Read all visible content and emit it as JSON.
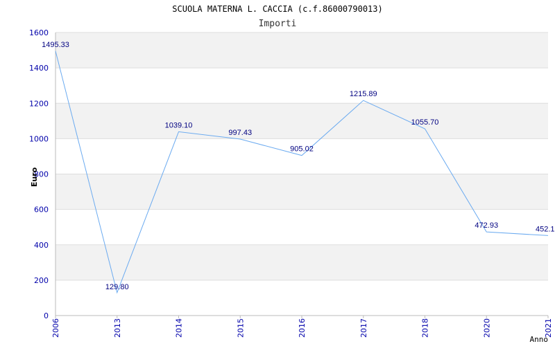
{
  "chart_data": {
    "type": "line",
    "title": "SCUOLA MATERNA L. CACCIA (c.f.86000790013)",
    "subtitle": "Importi",
    "xlabel": "Anno",
    "ylabel": "Euro",
    "ylim": [
      0,
      1600
    ],
    "yticks": [
      "0",
      "200",
      "400",
      "600",
      "800",
      "1000",
      "1200",
      "1400",
      "1600"
    ],
    "categories": [
      "2006",
      "2013",
      "2014",
      "2015",
      "2016",
      "2017",
      "2018",
      "2020",
      "2021"
    ],
    "values": [
      1495.33,
      129.8,
      1039.1,
      997.43,
      905.02,
      1215.89,
      1055.7,
      472.93,
      452.1
    ],
    "value_labels": [
      "1495.33",
      "129.80",
      "1039.10",
      "997.43",
      "905.02",
      "1215.89",
      "1055.70",
      "472.93",
      "452.1"
    ],
    "grid": true,
    "colors": {
      "line": "#6aaaf0",
      "tick_text": "#0000aa",
      "value_text": "#000080",
      "band": "#f2f2f2",
      "grid": "#dddddd"
    }
  }
}
